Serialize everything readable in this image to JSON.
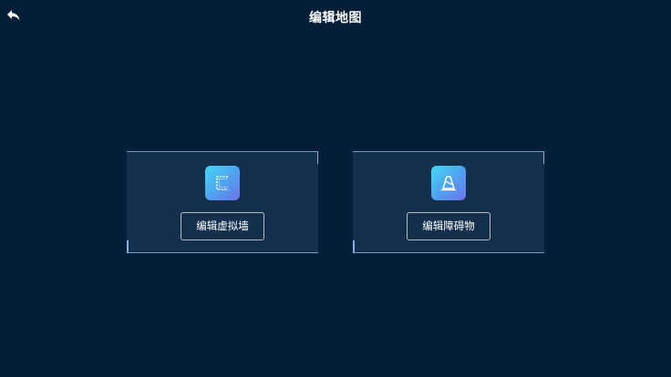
{
  "header": {
    "title": "编辑地图",
    "back_icon": "back-arrow-icon"
  },
  "cards": [
    {
      "label": "编辑虚拟墙",
      "icon": "virtual-wall-icon"
    },
    {
      "label": "编辑障碍物",
      "icon": "obstacle-cone-icon"
    }
  ],
  "colors": {
    "background": "#021f37",
    "card_background": "#14304d",
    "card_frame": "#6f9ecb",
    "icon_gradient_start": "#44d9f2",
    "icon_gradient_end": "#6d73ea",
    "button_border": "#aebccb",
    "text": "#ffffff"
  }
}
